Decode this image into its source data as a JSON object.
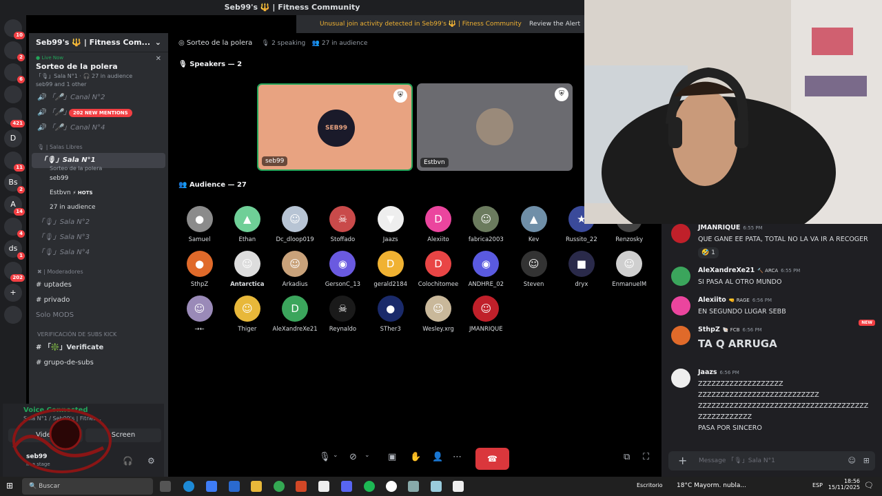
{
  "window": {
    "title": "Seb99's 🔱 | Fitness Community"
  },
  "alert": {
    "text": "Unusual join activity detected in Seb99's 🔱 | Fitness Community",
    "action": "Review the Alert"
  },
  "guild_badges": [
    "10",
    "2",
    "6",
    "",
    "421",
    "",
    "11",
    "2",
    "14",
    "4",
    "1",
    "202",
    "",
    ""
  ],
  "guild_letters": [
    "",
    "",
    "",
    "",
    "",
    "D",
    "",
    "Bs",
    "A",
    "",
    "ds",
    "",
    "+",
    ""
  ],
  "server": {
    "name": "Seb99's 🔱 | Fitness Com...",
    "live_now": "Live Now",
    "stage_title": "Sorteo de la polera",
    "stage_meta": "「🎙」Sala N°1 · 🎧 27 in audience",
    "stage_people": "seb99 and 1 other",
    "mentions": "202 NEW MENTIONS",
    "channels_top": [
      "「🎤」Canal N°2",
      "「🎤」Canal N°3",
      "「🎤」Canal N°4"
    ],
    "cat_salas": "🎙 | Salas Libres",
    "active_sala": "「🎙」Sala N°1",
    "active_sala_sub": "Sorteo de la polera",
    "sala_members": [
      "seb99",
      "Estbvn",
      "27 in audience"
    ],
    "hots": "⚡ HOTS",
    "salas": [
      "「🎙」Sala N°2",
      "「🎙」Sala N°3",
      "「🎙」Sala N°4"
    ],
    "cat_mod": "✖ | Moderadores",
    "text_channels": [
      "uptades",
      "privado",
      "Solo MODS"
    ],
    "cat_verif": "VERIFICACIÓN DE SUBS KICK",
    "verif_channels": [
      "「❇️」Verificate",
      "grupo-de-subs"
    ]
  },
  "voice": {
    "status": "Voice Connected",
    "channel": "Sala N°1 / Seb99's | Fitnes...",
    "video_label": "Video",
    "screen_label": "Screen",
    "user": "seb99",
    "user_sub": "In a stage"
  },
  "stage": {
    "title": "Sorteo de la polera",
    "speaking": "2 speaking",
    "audience_count": "27 in audience",
    "speakers_header": "Speakers — 2",
    "speakers": [
      {
        "name": "seb99",
        "color": "#e8a381",
        "logo": "SEB99"
      },
      {
        "name": "Estbvn",
        "color": "#6b6b70"
      }
    ],
    "audience_header": "Audience — 27",
    "audience": [
      {
        "name": "Samuel",
        "color": "#8b8b8b",
        "glyph": "●"
      },
      {
        "name": "Ethan",
        "color": "#6fcf97",
        "glyph": "▲"
      },
      {
        "name": "Dc_dloop019",
        "color": "#b7c4d4",
        "glyph": "☺"
      },
      {
        "name": "Stoffado",
        "color": "#c94a4a",
        "glyph": "☠"
      },
      {
        "name": "Jaazs",
        "color": "#eeeeee",
        "glyph": "▼"
      },
      {
        "name": "Alexiito",
        "color": "#eb459e",
        "glyph": "D"
      },
      {
        "name": "fabrica2003",
        "color": "#6b7b5e",
        "glyph": "☺"
      },
      {
        "name": "Kev",
        "color": "#6f8fa8",
        "glyph": "▲"
      },
      {
        "name": "Russito_22",
        "color": "#3a4a9a",
        "glyph": "★"
      },
      {
        "name": "Renzosky",
        "color": "#444444",
        "glyph": "●"
      },
      {
        "name": "SthpZ",
        "color": "#e06a2a",
        "glyph": "●"
      },
      {
        "name": "Antarctica",
        "color": "#dddddd",
        "glyph": "☺"
      },
      {
        "name": "Arkadius",
        "color": "#c9a27a",
        "glyph": "☺"
      },
      {
        "name": "GersonC_13",
        "color": "#6a5ae0",
        "glyph": "◉"
      },
      {
        "name": "gerald2184",
        "color": "#f0b232",
        "glyph": "D"
      },
      {
        "name": "Colochitomee",
        "color": "#e94545",
        "glyph": "D"
      },
      {
        "name": "ANDHRE_02",
        "color": "#5a5ae0",
        "glyph": "◉"
      },
      {
        "name": "Steven",
        "color": "#333333",
        "glyph": "☺"
      },
      {
        "name": "dryx",
        "color": "#2a2a4a",
        "glyph": "■"
      },
      {
        "name": "EnmanuelM",
        "color": "#cfcfcf",
        "glyph": "☺"
      },
      {
        "name": "→←",
        "color": "#9a8ab8",
        "glyph": "☺"
      },
      {
        "name": "Thiger",
        "color": "#e8b83a",
        "glyph": "☺"
      },
      {
        "name": "AleXandreXe21",
        "color": "#3ba55c",
        "glyph": "D"
      },
      {
        "name": "Reynaldo",
        "color": "#1a1a1a",
        "glyph": "☠"
      },
      {
        "name": "STher3",
        "color": "#1a2a6a",
        "glyph": "●"
      },
      {
        "name": "Wesley.xrg",
        "color": "#c9b89a",
        "glyph": "☺"
      },
      {
        "name": "JMANRIQUE",
        "color": "#c0202a",
        "glyph": "☺"
      }
    ]
  },
  "chat": {
    "messages": [
      {
        "user": "JMANRIQUE",
        "tag": "",
        "time": "6:55 PM",
        "lines": [
          "QUE GANE EE PATA, TOTAL NO LA VA IR A RECOGER"
        ],
        "color": "#c0202a",
        "reaction": "🤣 1"
      },
      {
        "user": "AleXandreXe21",
        "tag": "🔨 ARCA",
        "time": "6:55 PM",
        "lines": [
          "SI PASA AL OTRO MUNDO"
        ],
        "color": "#3ba55c"
      },
      {
        "user": "Alexiito",
        "tag": "🤜 RAGE",
        "time": "6:56 PM",
        "lines": [
          "EN SEGUNDO LUGAR SEBB"
        ],
        "color": "#eb459e"
      },
      {
        "user": "SthpZ",
        "tag": "🐚 FCB",
        "time": "6:56 PM",
        "lines": [
          "TA Q ARRUGA"
        ],
        "color": "#e06a2a",
        "big": true
      },
      {
        "user": "Jaazs",
        "tag": "",
        "time": "6:56 PM",
        "lines": [
          "ZZZZZZZZZZZZZZZZZZZ",
          "ZZZZZZZZZZZZZZZZZZZZZZZZZZZ",
          "ZZZZZZZZZZZZZZZZZZZZZZZZZZZZZZZZZZZZZZ",
          "ZZZZZZZZZZZZ",
          "PASA POR SINCERO"
        ],
        "color": "#eeeeee"
      }
    ],
    "new_label": "NEW",
    "input_placeholder": "Message 「🎙」Sala N°1"
  },
  "taskbar": {
    "search": "Buscar",
    "desktop": "Escritorio",
    "weather": "18°C  Mayorm. nubla...",
    "lang": "ESP",
    "time": "18:56",
    "date": "15/11/2025"
  }
}
